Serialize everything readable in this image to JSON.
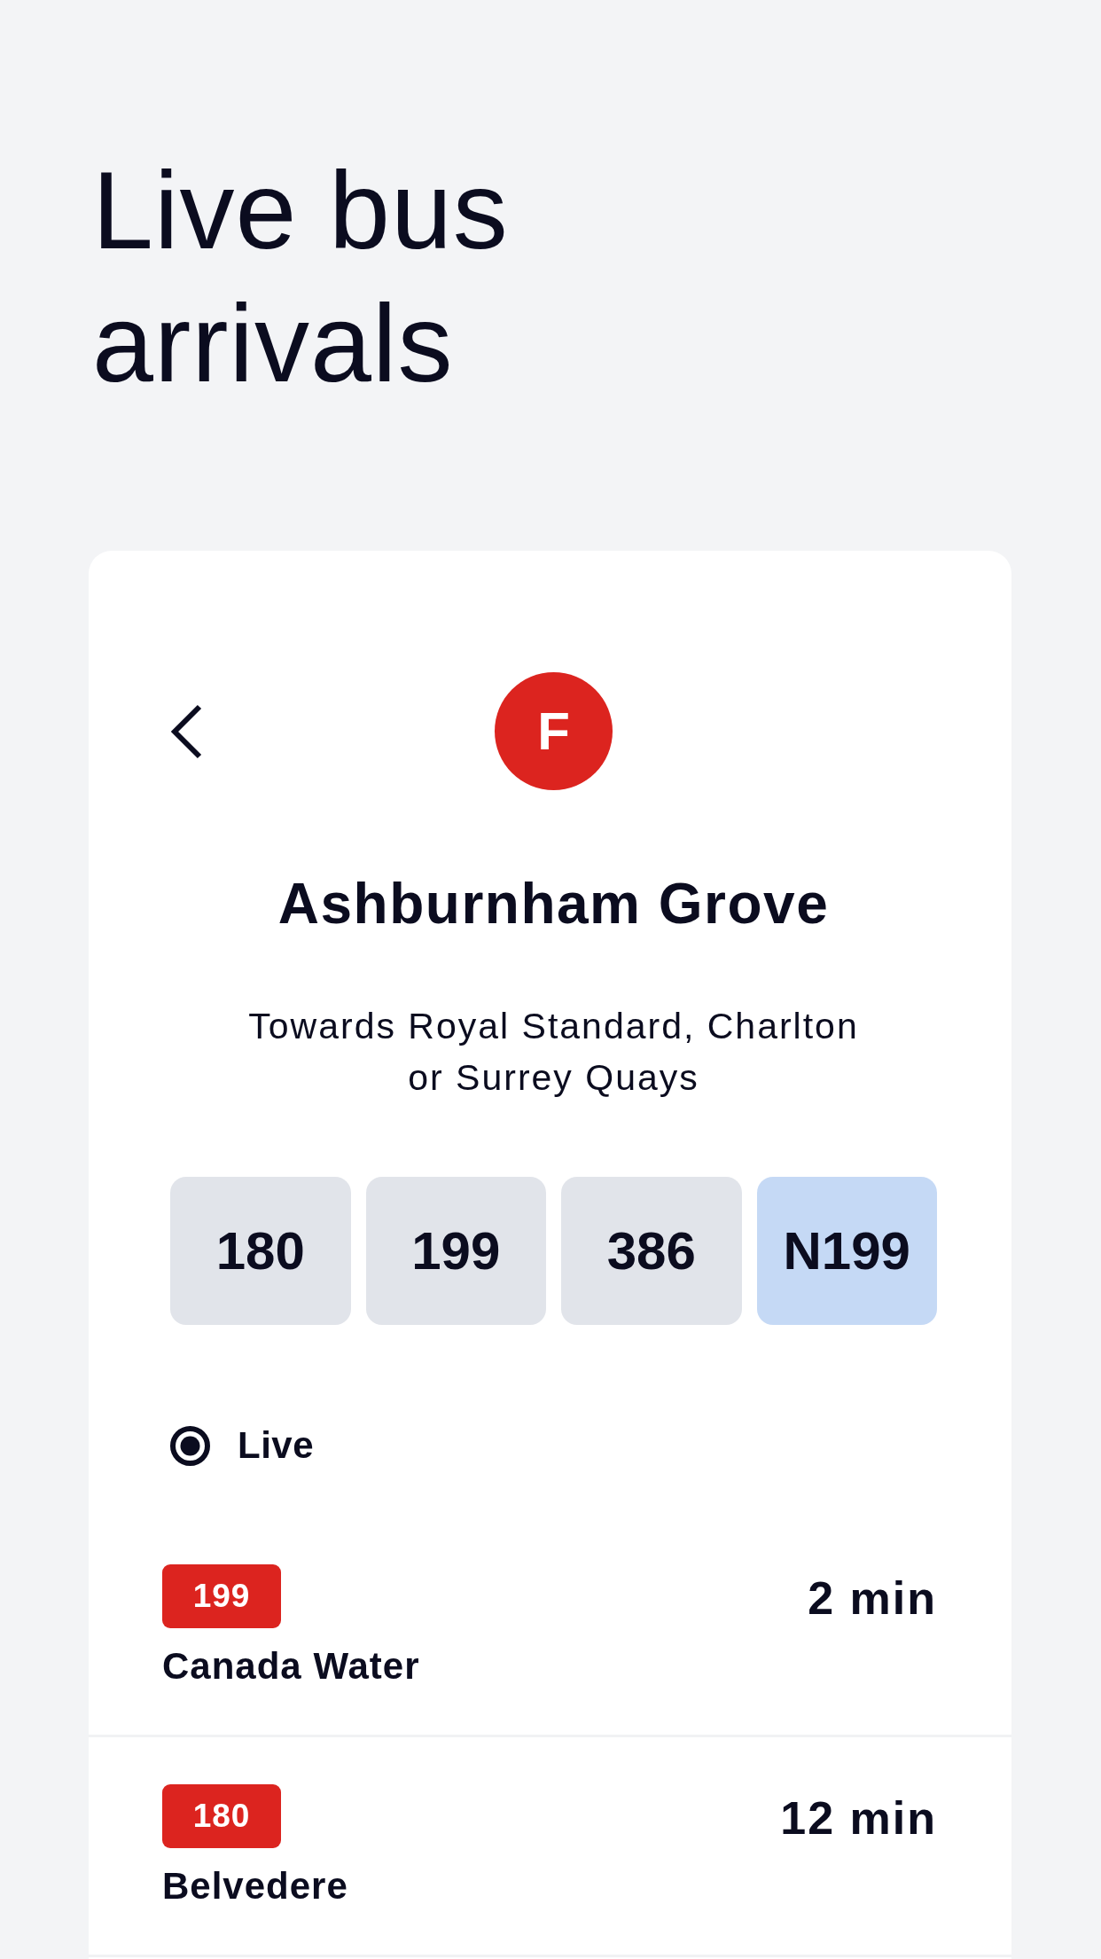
{
  "heading": "Live bus arrivals",
  "stop": {
    "letter": "F",
    "name": "Ashburnham Grove",
    "towards": "Towards Royal Standard, Charlton or Surrey Quays"
  },
  "routes": [
    {
      "label": "180",
      "selected": false
    },
    {
      "label": "199",
      "selected": false
    },
    {
      "label": "386",
      "selected": false
    },
    {
      "label": "N199",
      "selected": true
    }
  ],
  "live": {
    "label": "Live",
    "selected": true
  },
  "arrivals": [
    {
      "route": "199",
      "destination": "Canada Water",
      "due": "2 min"
    },
    {
      "route": "180",
      "destination": "Belvedere",
      "due": "12 min"
    }
  ]
}
